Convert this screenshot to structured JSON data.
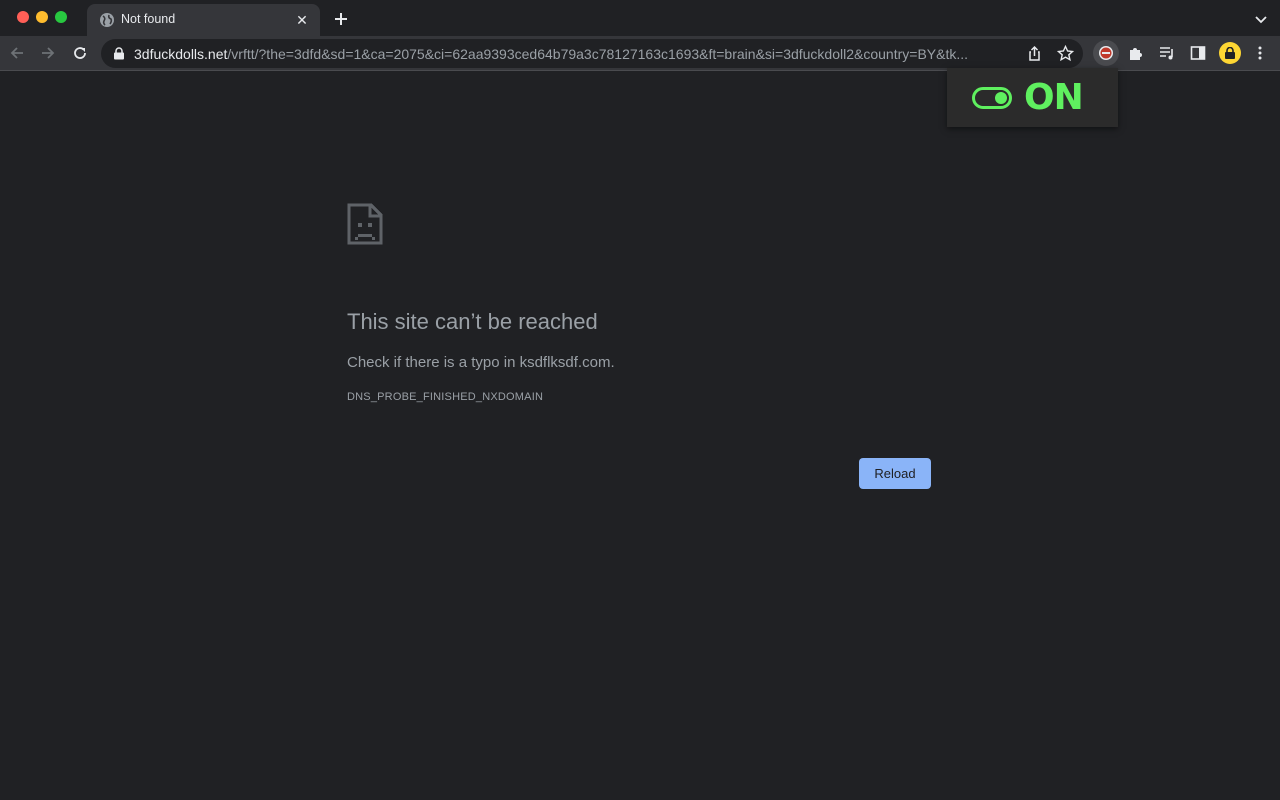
{
  "tab": {
    "title": "Not found",
    "close_glyph": "✕"
  },
  "omnibox": {
    "host": "3dfuckdolls.net",
    "path": "/vrftt/?the=3dfd&sd=1&ca=2075&ci=62aa9393ced64b79a3c78127163c1693&ft=brain&si=3dfuckdoll2&country=BY&tk..."
  },
  "extension_popup": {
    "label": "ON",
    "toggle_state": "on",
    "accent_color": "#5ff05f"
  },
  "error": {
    "title": "This site can’t be reached",
    "description": "Check if there is a typo in ksdflksdf.com.",
    "code": "DNS_PROBE_FINISHED_NXDOMAIN",
    "reload_label": "Reload"
  },
  "colors": {
    "background": "#202124",
    "toolbar": "#35363a",
    "button": "#8ab4f8",
    "text": "#9aa0a6"
  }
}
